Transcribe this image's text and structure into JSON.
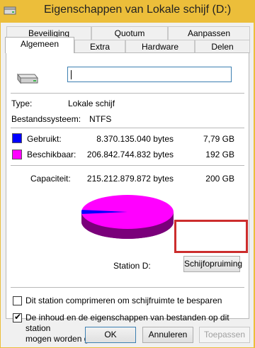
{
  "window": {
    "title": "Eigenschappen van Lokale schijf (D:)",
    "frame_color": "#ecbe3a"
  },
  "tabs": {
    "row1": [
      "Beveiliging",
      "Quotum",
      "Aanpassen"
    ],
    "row2": [
      "Algemeen",
      "Extra",
      "Hardware",
      "Delen"
    ],
    "active": "Algemeen"
  },
  "general": {
    "name_value": "",
    "type_label": "Type:",
    "type_value": "Lokale schijf",
    "fs_label": "Bestandssysteem:",
    "fs_value": "NTFS",
    "used_label": "Gebruikt:",
    "used_bytes": "8.370.135.040 bytes",
    "used_gb": "7,79 GB",
    "free_label": "Beschikbaar:",
    "free_bytes": "206.842.744.832 bytes",
    "free_gb": "192 GB",
    "capacity_label": "Capaciteit:",
    "capacity_bytes": "215.212.879.872 bytes",
    "capacity_gb": "200 GB",
    "used_color": "#0000ff",
    "free_color": "#ff00ff",
    "used_fraction": 0.0389,
    "drive_label": "Station D:",
    "cleanup_button": "Schijfopruiming",
    "compress_label": "Dit station comprimeren om schijfruimte te besparen",
    "compress_checked": false,
    "index_label_line1": "De inhoud en de eigenschappen van bestanden op dit station",
    "index_label_line2": "mogen worden geïndexeerd",
    "index_checked": true
  },
  "buttons": {
    "ok": "OK",
    "cancel": "Annuleren",
    "apply": "Toepassen"
  },
  "icons": {
    "title": "drive-icon",
    "drive": "hard-drive-icon"
  }
}
